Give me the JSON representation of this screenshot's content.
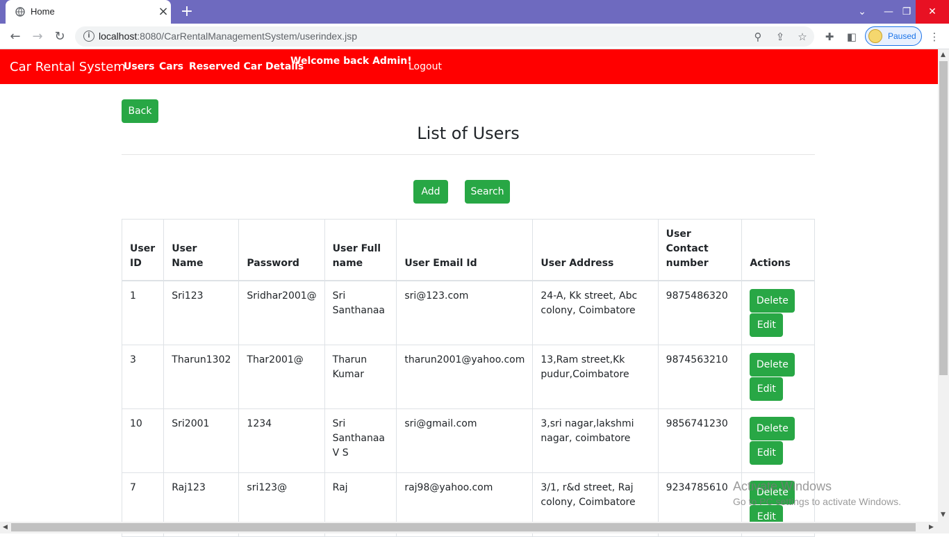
{
  "browser": {
    "tab_title": "Home",
    "url_host": "localhost",
    "url_rest": ":8080/CarRentalManagementSystem/userindex.jsp",
    "profile_label": "Paused",
    "tab_close_glyph": "×",
    "newtab_glyph": "+"
  },
  "nav": {
    "brand": "Car Rental System",
    "users": "Users",
    "cars": "Cars",
    "reserved": "Reserved Car Details",
    "welcome": "Welcome back Admin!",
    "logout": "Logout"
  },
  "page": {
    "back_label": "Back",
    "heading": "List of Users",
    "add_label": "Add",
    "search_label": "Search"
  },
  "table": {
    "headers": [
      "User ID",
      "User Name",
      "Password",
      "User Full name",
      "User Email Id",
      "User Address",
      "User Contact number",
      "Actions"
    ],
    "rows": [
      {
        "id": "1",
        "name": "Sri123",
        "password": "Sridhar2001@",
        "full": "Sri Santhanaa",
        "email": "sri@123.com",
        "address": "24-A, Kk street, Abc colony, Coimbatore",
        "contact": "9875486320"
      },
      {
        "id": "3",
        "name": "Tharun1302",
        "password": "Thar2001@",
        "full": "Tharun Kumar",
        "email": "tharun2001@yahoo.com",
        "address": "13,Ram street,Kk pudur,Coimbatore",
        "contact": "9874563210"
      },
      {
        "id": "10",
        "name": "Sri2001",
        "password": "1234",
        "full": "Sri Santhanaa V S",
        "email": "sri@gmail.com",
        "address": "3,sri nagar,lakshmi nagar, coimbatore",
        "contact": "9856741230"
      },
      {
        "id": "7",
        "name": "Raj123",
        "password": "sri123@",
        "full": "Raj",
        "email": "raj98@yahoo.com",
        "address": "3/1, r&d street, Raj colony, Coimbatore",
        "contact": "9234785610"
      }
    ],
    "delete_label": "Delete",
    "edit_label": "Edit"
  },
  "watermark": {
    "title": "Activate Windows",
    "subtitle": "Go to PC settings to activate Windows."
  },
  "colors": {
    "navbar": "#ff0000",
    "button": "#28a745",
    "tabbar": "#6e6abf"
  }
}
